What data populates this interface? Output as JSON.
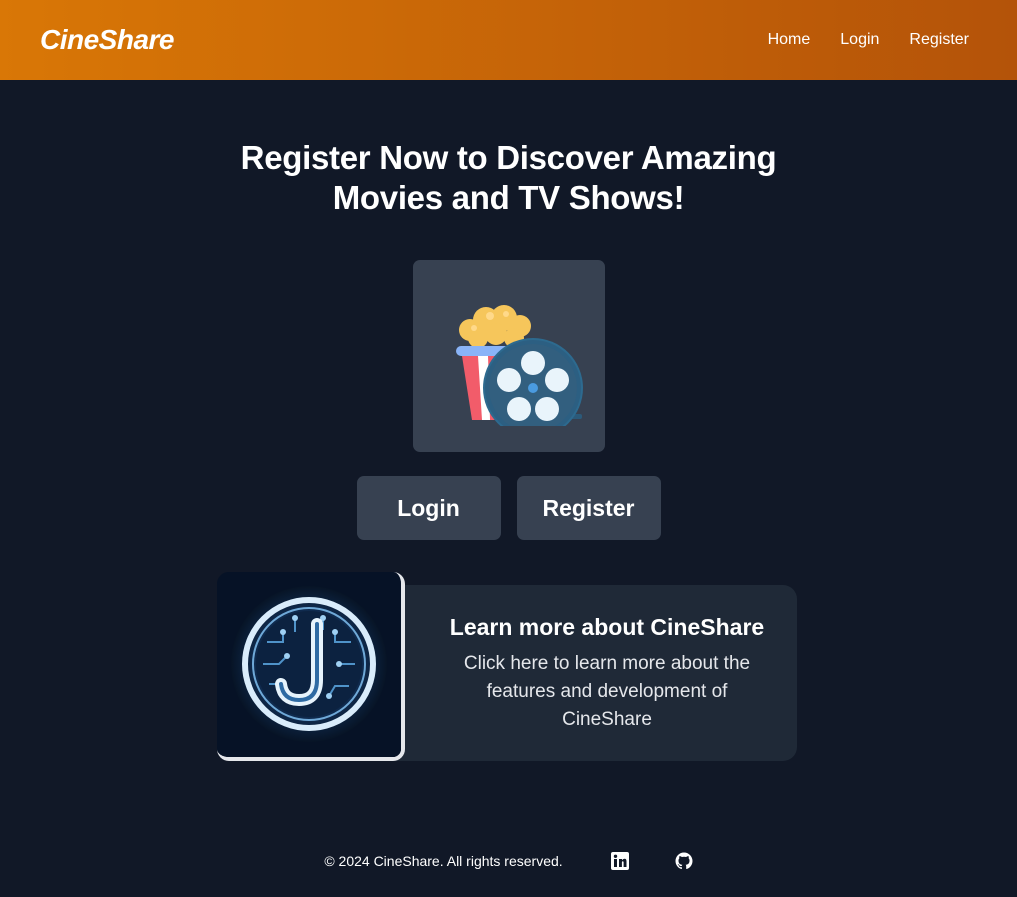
{
  "navbar": {
    "brand": "CineShare",
    "links": [
      {
        "label": "Home"
      },
      {
        "label": "Login"
      },
      {
        "label": "Register"
      }
    ]
  },
  "hero": {
    "headline": "Register Now to Discover Amazing Movies and TV Shows!",
    "image_icon": "popcorn-film-reel-icon",
    "buttons": {
      "login_label": "Login",
      "register_label": "Register"
    }
  },
  "info_card": {
    "logo_icon": "circuit-j-logo-icon",
    "title": "Learn more about CineShare",
    "description": "Click here to learn more about the features and development of CineShare"
  },
  "footer": {
    "copyright": "© 2024 CineShare. All rights reserved.",
    "social": [
      {
        "icon": "linkedin-icon"
      },
      {
        "icon": "github-icon"
      }
    ]
  },
  "colors": {
    "navbar_gradient_start": "#d97706",
    "navbar_gradient_end": "#b45309",
    "page_background": "#111827",
    "button_background": "#374151",
    "card_background": "#1f2937"
  }
}
